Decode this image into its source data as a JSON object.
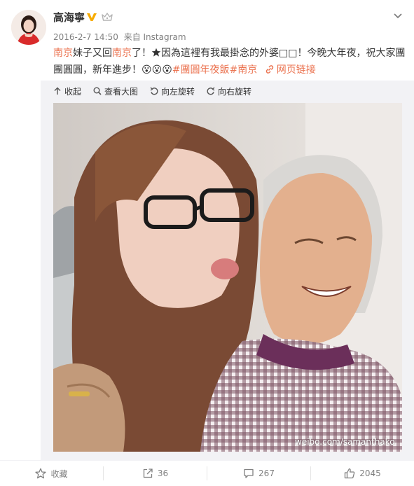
{
  "post": {
    "author": "高海寧",
    "timestamp": "2016-2-7 14:50",
    "source": "来自 Instagram",
    "text": {
      "loc1": "南京",
      "part1": "妹子又回",
      "loc2": "南京",
      "part2": "了！",
      "part3": "因為這裡有我最掛念的外婆",
      "boxes": "□□",
      "part4": "！今晚大年夜，祝大家團團圓圓，新年進步！",
      "emoji": "😮😮😮",
      "tag1": "#團圓年夜飯",
      "tag2": "#南京",
      "weblink": "网页链接"
    }
  },
  "toolbar": {
    "collapse": "收起",
    "view_large": "查看大图",
    "rotate_left": "向左旋转",
    "rotate_right": "向右旋转"
  },
  "image": {
    "watermark": "weibo.com/samanthako"
  },
  "footer": {
    "favorite": "收藏",
    "repost_count": "36",
    "comment_count": "267",
    "like_count": "2045"
  },
  "colors": {
    "accent": "#eb7350",
    "vip": "#f7ab00",
    "text": "#333333",
    "meta": "#808080"
  }
}
